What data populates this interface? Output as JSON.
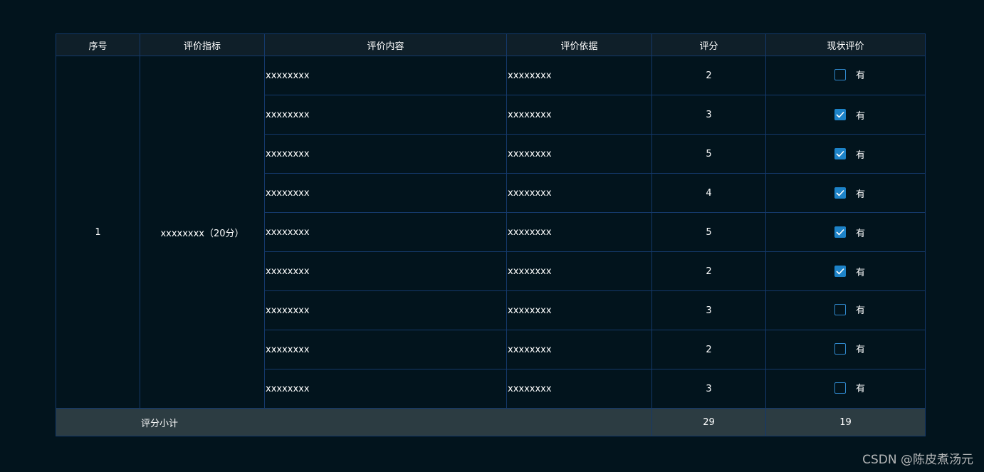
{
  "table": {
    "headers": [
      "序号",
      "评价指标",
      "评价内容",
      "评价依据",
      "评分",
      "现状评价"
    ],
    "group": {
      "index": "1",
      "indicator": "xxxxxxxx（20分）"
    },
    "rows": [
      {
        "content": "xxxxxxxx",
        "basis": "xxxxxxxx",
        "score": "2",
        "checked": false,
        "check_label": "有"
      },
      {
        "content": "xxxxxxxx",
        "basis": "xxxxxxxx",
        "score": "3",
        "checked": true,
        "check_label": "有"
      },
      {
        "content": "xxxxxxxx",
        "basis": "xxxxxxxx",
        "score": "5",
        "checked": true,
        "check_label": "有"
      },
      {
        "content": "xxxxxxxx",
        "basis": "xxxxxxxx",
        "score": "4",
        "checked": true,
        "check_label": "有"
      },
      {
        "content": "xxxxxxxx",
        "basis": "xxxxxxxx",
        "score": "5",
        "checked": true,
        "check_label": "有"
      },
      {
        "content": "xxxxxxxx",
        "basis": "xxxxxxxx",
        "score": "2",
        "checked": true,
        "check_label": "有"
      },
      {
        "content": "xxxxxxxx",
        "basis": "xxxxxxxx",
        "score": "3",
        "checked": false,
        "check_label": "有"
      },
      {
        "content": "xxxxxxxx",
        "basis": "xxxxxxxx",
        "score": "2",
        "checked": false,
        "check_label": "有"
      },
      {
        "content": "xxxxxxxx",
        "basis": "xxxxxxxx",
        "score": "3",
        "checked": false,
        "check_label": "有"
      }
    ],
    "footer": {
      "label": "评分小计",
      "score_total": "29",
      "status_total": "19"
    }
  },
  "watermark": "CSDN @陈皮煮汤元",
  "colors": {
    "background": "#02141d",
    "header_bg": "#0f1f29",
    "border": "#14396b",
    "footer_bg": "#2c3c42",
    "checkbox_accent": "#1d83c8"
  }
}
